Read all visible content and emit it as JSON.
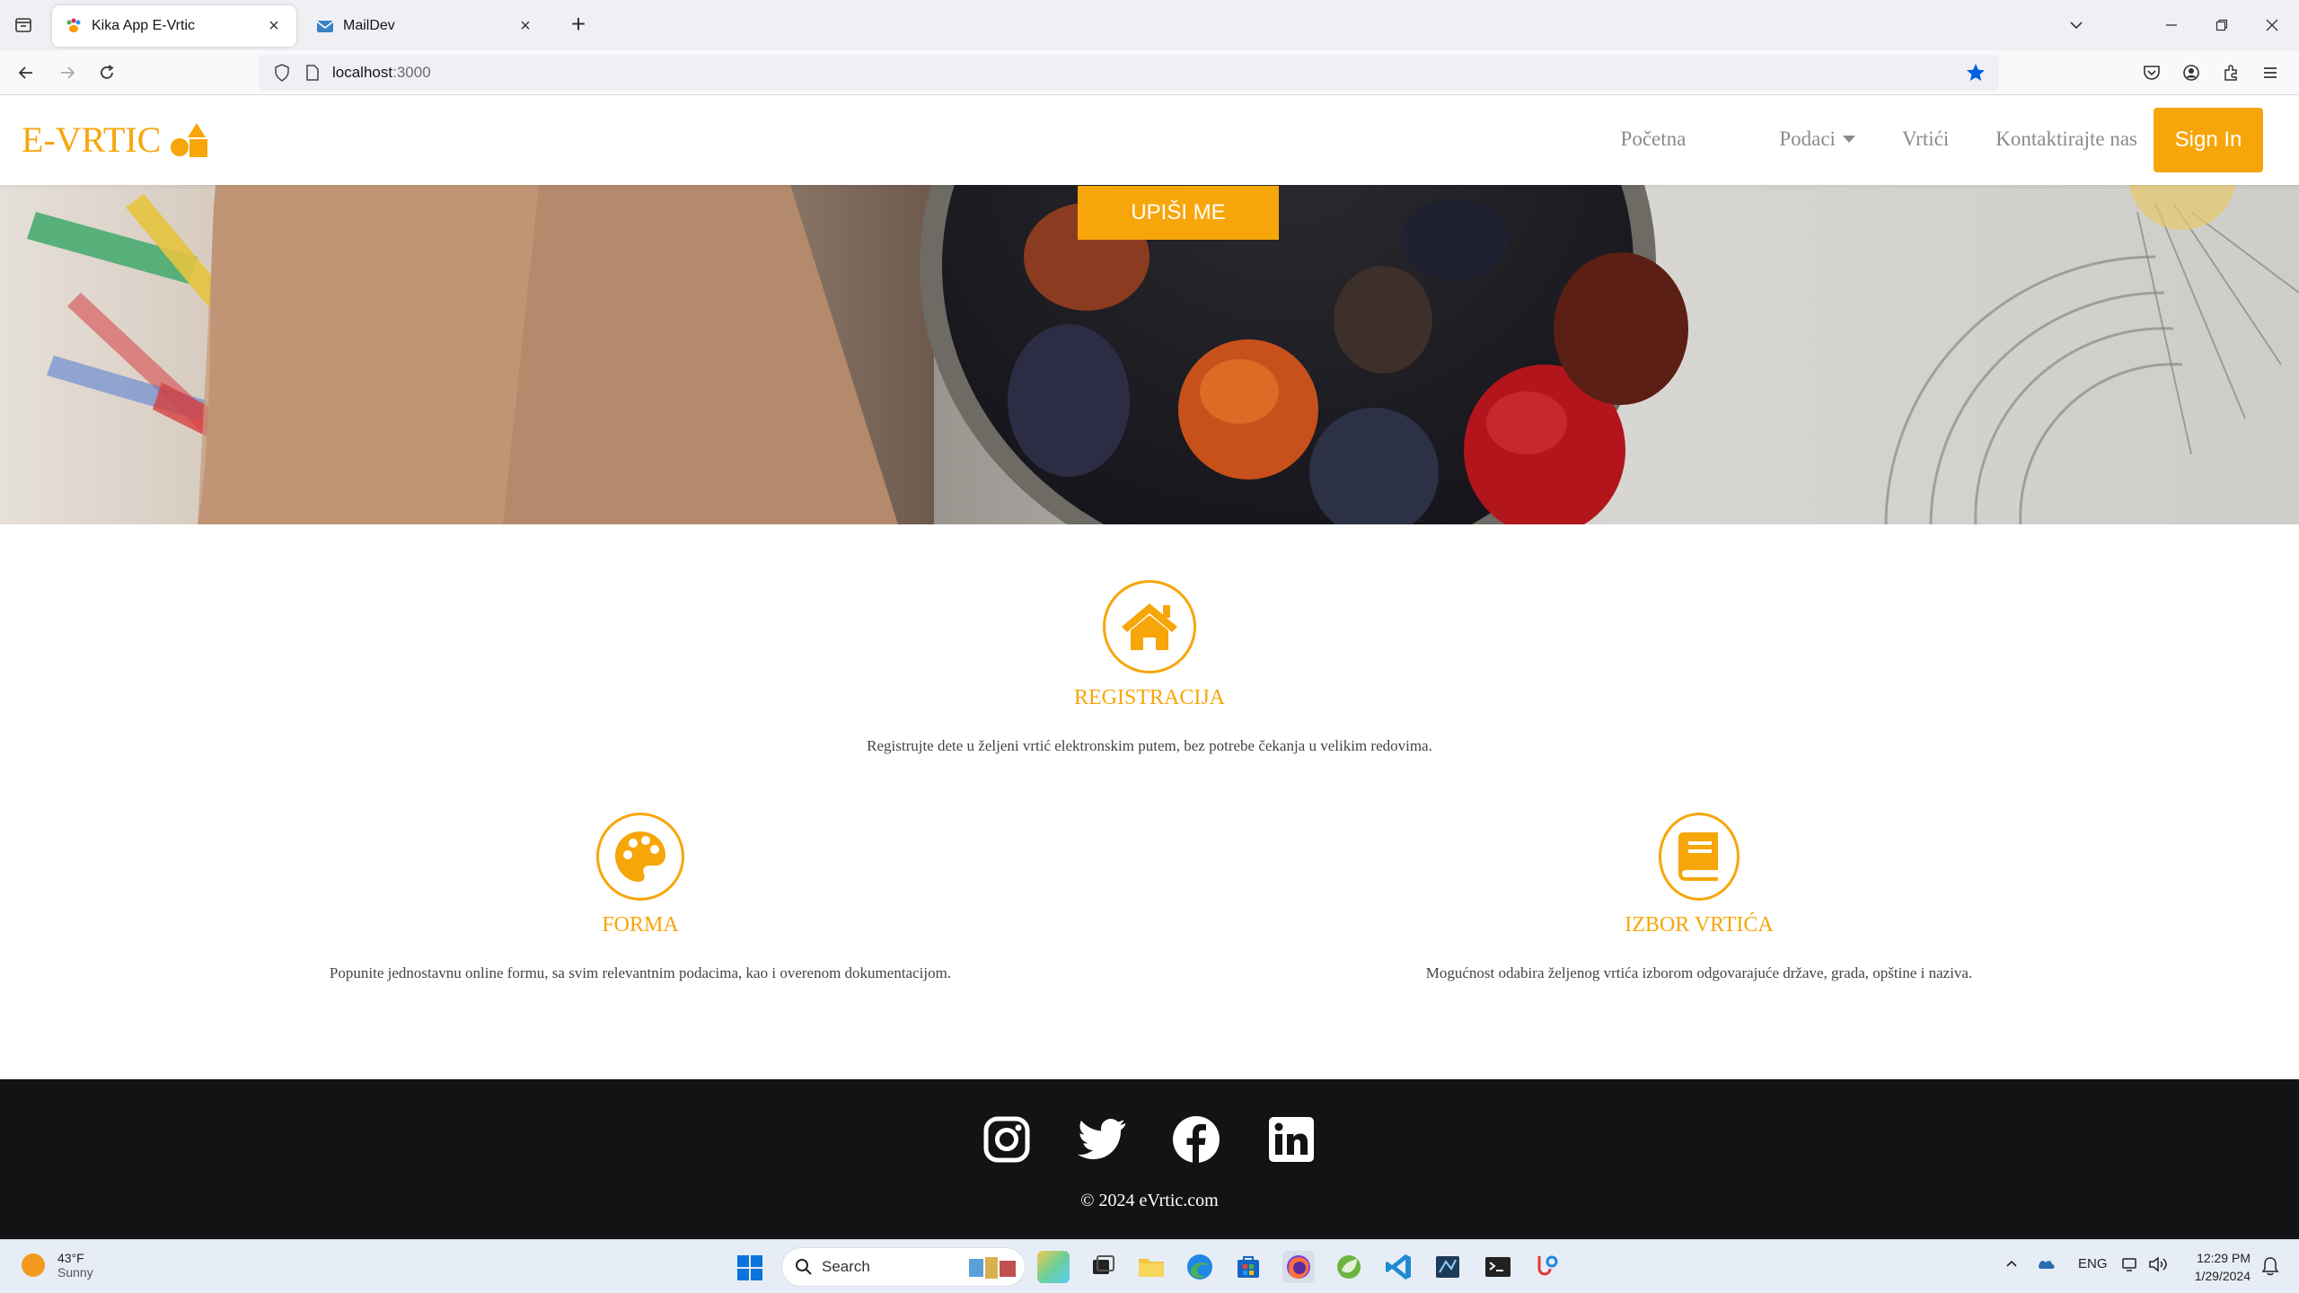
{
  "browser": {
    "tabs": [
      {
        "title": "Kika App E-Vrtic",
        "active": true
      },
      {
        "title": "MailDev",
        "active": false
      }
    ],
    "url_host": "localhost",
    "url_port": ":3000"
  },
  "site": {
    "brand": "E-VRTIC",
    "nav": [
      {
        "label": "Početna"
      },
      {
        "label": "Podaci",
        "dropdown": true
      },
      {
        "label": "Vrtići"
      },
      {
        "label": "Kontaktirajte nas"
      }
    ],
    "signin_label": "Sign In",
    "hero_cta": "UPIŠI ME",
    "accent": "#f7a60a",
    "features": [
      {
        "icon": "home-icon",
        "title": "REGISTRACIJA",
        "text": "Registrujte dete u željeni vrtić elektronskim putem, bez potrebe čekanja u velikim redovima."
      },
      {
        "icon": "palette-icon",
        "title": "FORMA",
        "text": "Popunite jednostavnu online formu, sa svim relevantnim podacima, kao i overenom dokumentacijom."
      },
      {
        "icon": "book-icon",
        "title": "IZBOR VRTIĆA",
        "text": "Mogućnost odabira željenog vrtića izborom odgovarajuće države, grada, opštine i naziva."
      }
    ],
    "social": [
      "instagram-icon",
      "twitter-icon",
      "facebook-icon",
      "linkedin-icon"
    ],
    "copyright": "© 2024 eVrtic.com"
  },
  "taskbar": {
    "weather_temp": "43°F",
    "weather_desc": "Sunny",
    "search_label": "Search",
    "lang": "ENG",
    "time": "12:29 PM",
    "date": "1/29/2024"
  }
}
